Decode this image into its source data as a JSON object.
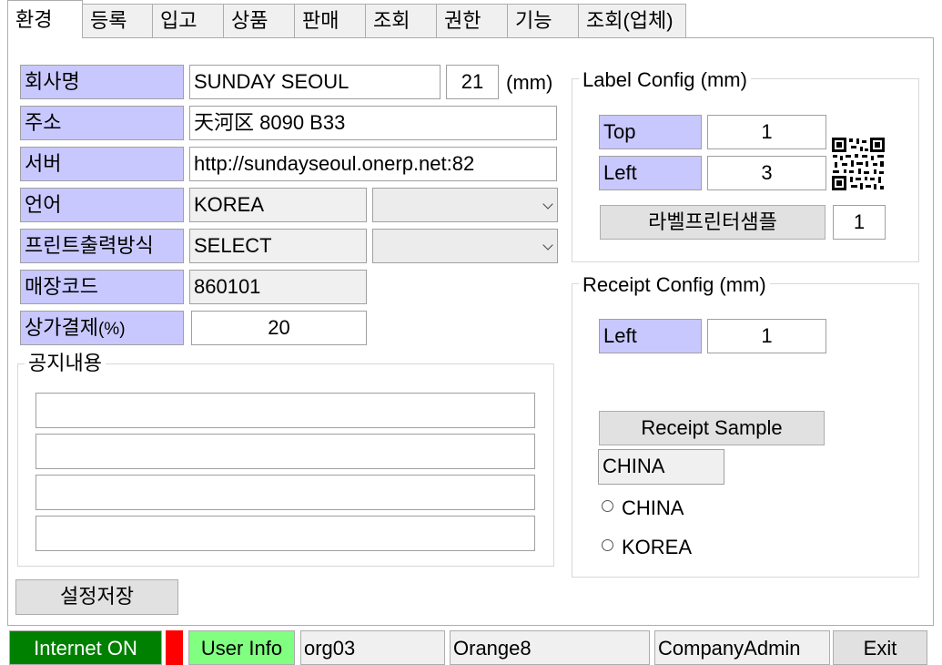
{
  "tabs": [
    "환경",
    "등록",
    "입고",
    "상품",
    "판매",
    "조회",
    "권한",
    "기능",
    "조회(업체)"
  ],
  "form": {
    "company_label": "회사명",
    "company_value": "SUNDAY SEOUL",
    "font_size_value": "21",
    "font_size_unit": "(mm)",
    "address_label": "주소",
    "address_value": "天河区 8090 B33",
    "server_label": "서버",
    "server_value": "http://sundayseoul.onerp.net:82",
    "language_label": "언어",
    "language_value": "KOREA",
    "print_mode_label": "프린트출력방식",
    "print_mode_value": "SELECT",
    "store_code_label": "매장코드",
    "store_code_value": "860101",
    "payment_label_main": "상가결제",
    "payment_label_suffix": "(%)",
    "payment_value": "20"
  },
  "notice": {
    "title": "공지내용",
    "lines": [
      "",
      "",
      "",
      ""
    ]
  },
  "save_button": "설정저장",
  "label_config": {
    "title": "Label Config (mm)",
    "top_label": "Top",
    "top_value": "1",
    "left_label": "Left",
    "left_value": "3",
    "sample_button": "라벨프린터샘플",
    "sample_count": "1"
  },
  "receipt_config": {
    "title": "Receipt Config (mm)",
    "left_label": "Left",
    "left_value": "1",
    "sample_button": "Receipt Sample",
    "selected_value": "CHINA",
    "options": [
      "CHINA",
      "KOREA"
    ]
  },
  "status_bar": {
    "internet": "Internet ON",
    "user_info": "User Info",
    "org": "org03",
    "user": "Orange8",
    "role": "CompanyAdmin",
    "exit": "Exit"
  },
  "colors": {
    "label_bg": "#c8c8ff",
    "internet_bg": "#008000",
    "indicator": "#ff0000",
    "user_info_bg": "#80ff80"
  }
}
